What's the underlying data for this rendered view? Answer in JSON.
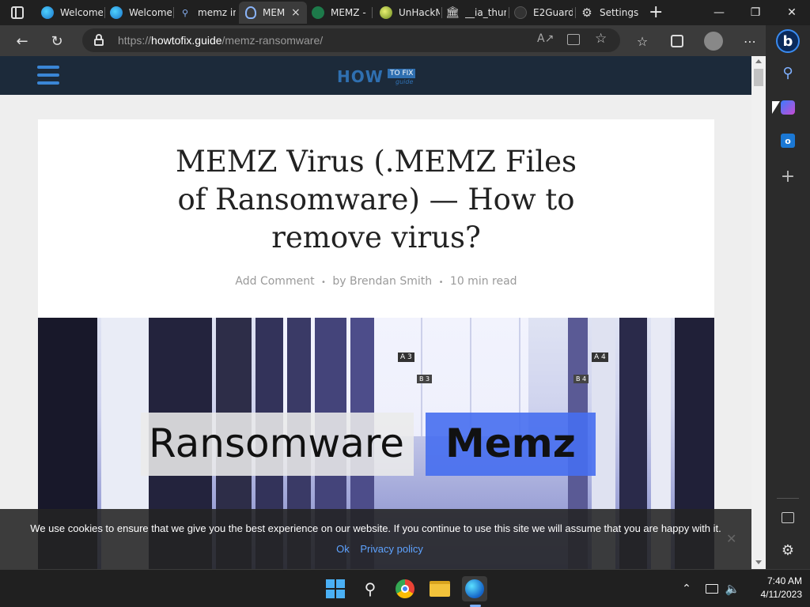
{
  "browser": {
    "tabs": [
      {
        "label": "Welcome",
        "favicon": "edge-icon"
      },
      {
        "label": "Welcome",
        "favicon": "edge-icon"
      },
      {
        "label": "memz in",
        "favicon": "search-icon"
      },
      {
        "label": "MEM",
        "favicon": "shield-icon",
        "active": true
      },
      {
        "label": "MEMZ -",
        "favicon": "green-logo-icon"
      },
      {
        "label": "UnHackM",
        "favicon": "ball-icon"
      },
      {
        "label": "__ia_thun",
        "favicon": "archive-icon"
      },
      {
        "label": "E2Guard",
        "favicon": "github-icon"
      },
      {
        "label": "Settings",
        "favicon": "gear-icon"
      }
    ],
    "close_tab_glyph": "×",
    "new_tab_glyph": "+",
    "url_prefix": "https://",
    "url_domain": "howtofix.guide",
    "url_path": "/memz-ransomware/",
    "window_controls": {
      "minimize": "—",
      "maximize": "❐",
      "close": "✕"
    }
  },
  "site": {
    "logo_main": "HOW",
    "logo_badge": "TO FIX",
    "logo_sub": "guide"
  },
  "article": {
    "title": "MEMZ Virus (.MEMZ Files of Ransomware) — How to remove virus?",
    "meta": {
      "comment": "Add Comment",
      "author": "by Brendan Smith",
      "read_time": "10 min read",
      "sep": "•"
    },
    "hero": {
      "label_left": "Ransomware",
      "label_right": "Memz",
      "signs": [
        "A 3",
        "A 4",
        "B 3",
        "B 4"
      ]
    }
  },
  "cookie_banner": {
    "text": "We use cookies to ensure that we give you the best experience on our website. If you continue to use this site we will assume that you are happy with it.",
    "ok": "Ok",
    "privacy": "Privacy policy",
    "close": "✕"
  },
  "taskbar": {
    "time": "7:40 AM",
    "date": "4/11/2023"
  },
  "colors": {
    "site_header": "#1c2a3a",
    "accent_blue": "#3a86d6",
    "link_blue": "#5ea3ff"
  }
}
